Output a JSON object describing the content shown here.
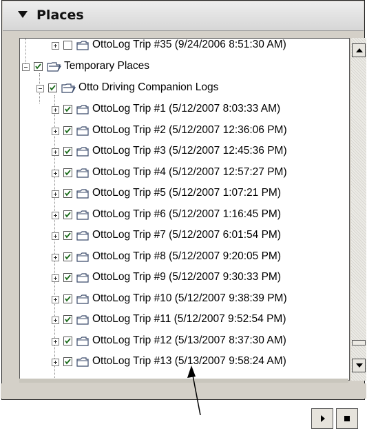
{
  "header": {
    "title": "Places",
    "collapse_icon": "triangle-down-icon"
  },
  "tree": {
    "top_item": {
      "label": "OttoLog Trip #35 (9/24/2006 8:51:30 AM)",
      "checked": false
    },
    "temporary_places": {
      "label": "Temporary Places",
      "checked": true
    },
    "otto_logs": {
      "label": "Otto Driving Companion Logs",
      "checked": true
    },
    "trips": [
      {
        "label": "OttoLog Trip #1 (5/12/2007 8:03:33 AM)",
        "checked": true
      },
      {
        "label": "OttoLog Trip #2 (5/12/2007 12:36:06 PM)",
        "checked": true
      },
      {
        "label": "OttoLog Trip #3 (5/12/2007 12:45:36 PM)",
        "checked": true
      },
      {
        "label": "OttoLog Trip #4 (5/12/2007 12:57:27 PM)",
        "checked": true
      },
      {
        "label": "OttoLog Trip #5 (5/12/2007 1:07:21 PM)",
        "checked": true
      },
      {
        "label": "OttoLog Trip #6 (5/12/2007 1:16:45 PM)",
        "checked": true
      },
      {
        "label": "OttoLog Trip #7 (5/12/2007 6:01:54 PM)",
        "checked": true
      },
      {
        "label": "OttoLog Trip #8 (5/12/2007 9:20:05 PM)",
        "checked": true
      },
      {
        "label": "OttoLog Trip #9 (5/12/2007 9:30:33 PM)",
        "checked": true
      },
      {
        "label": "OttoLog Trip #10 (5/12/2007 9:38:39 PM)",
        "checked": true
      },
      {
        "label": "OttoLog Trip #11 (5/12/2007 9:52:54 PM)",
        "checked": true
      },
      {
        "label": "OttoLog Trip #12 (5/13/2007 8:37:30 AM)",
        "checked": true
      },
      {
        "label": "OttoLog Trip #13 (5/13/2007 9:58:24 AM)",
        "checked": true
      }
    ]
  },
  "controls": {
    "play_icon": "play-icon",
    "stop_icon": "stop-icon"
  },
  "colors": {
    "panel_bg": "#d4d0c8",
    "check": "#1a6b1a",
    "folder": "#3a4a6a"
  }
}
